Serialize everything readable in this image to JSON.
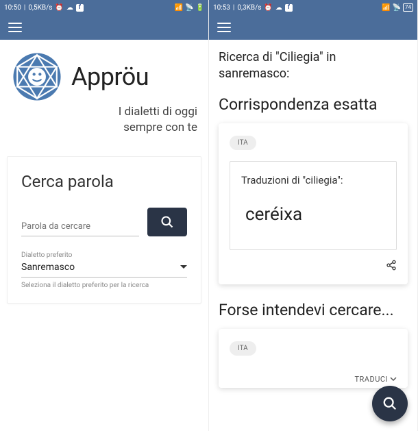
{
  "left": {
    "status": {
      "time": "10:50",
      "net": "0,5KB/s"
    },
    "app_name": "Appröu",
    "tagline_line1": "I dialetti di oggi",
    "tagline_line2": "sempre con te",
    "search_card": {
      "title": "Cerca parola",
      "placeholder": "Parola da cercare",
      "dialect_label": "Dialetto preferito",
      "dialect_value": "Sanremasco",
      "dialect_help": "Seleziona il dialetto preferito per la ricerca"
    }
  },
  "right": {
    "status": {
      "time": "10:53",
      "net": "0,3KB/s",
      "battery": "74"
    },
    "search_info": "Ricerca di \"Ciliegia\" in sanremasco:",
    "exact_title": "Corrispondenza esatta",
    "result": {
      "lang": "ITA",
      "trans_label": "Traduzioni di \"ciliegia\":",
      "trans_word": "ceréixa"
    },
    "suggest_title": "Forse intendevi cercare...",
    "suggest": {
      "lang": "ITA",
      "action": "TRADUCI"
    }
  }
}
